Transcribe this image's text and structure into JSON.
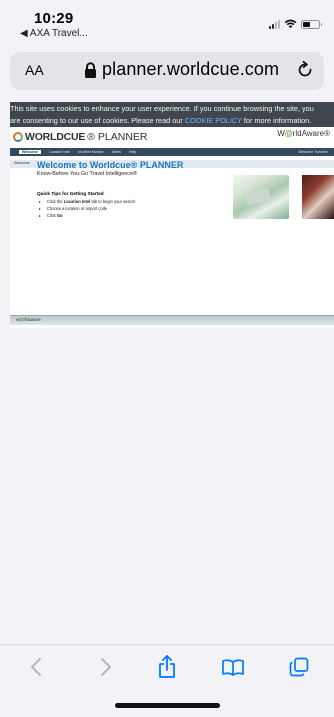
{
  "status_bar": {
    "time": "10:29",
    "back_app": "◀ AXA Travel..."
  },
  "address_bar": {
    "reader_label": "AA",
    "url": "planner.worldcue.com"
  },
  "web": {
    "cookie_banner": {
      "text_line1": "This site uses cookies to enhance your user experience. If you continue browsing the site, you",
      "text_line2_start": "are consenting to our use of cookies. Please read our ",
      "policy_link": "COOKIE POLICY",
      "text_line2_end": " for more information."
    },
    "header": {
      "logo_bold": "WORLDCUE",
      "logo_light": "® PLANNER",
      "partner_logo_pre": "W",
      "partner_logo_accent": "@",
      "partner_logo_post": "rldAware®"
    },
    "nav": {
      "items": [
        "Welcome",
        "Location Intel",
        "Incident Monitor",
        "Alerts",
        "Help"
      ],
      "right_text": "Welcome Traveller"
    },
    "breadcrumb": "Welcome",
    "content": {
      "welcome_title": "Welcome to Worldcue® PLANNER",
      "subtitle": "Know-Before-You-Go Travel Intelligence®",
      "tips_title": "Quick Tips for Getting Started",
      "tips": [
        {
          "pre": "Click the ",
          "bold": "Location Intel",
          "post": " tab to begin your search"
        },
        {
          "pre": "Choose a location or airport code",
          "bold": "",
          "post": ""
        },
        {
          "pre": "Click ",
          "bold": "Go",
          "post": ""
        }
      ]
    },
    "footer_logo": "w@rldaware"
  },
  "colors": {
    "accent": "#1a78c2",
    "nav_bg": "#35485e",
    "cookie_bg": "#40464d",
    "ios_blue": "#007aff"
  }
}
